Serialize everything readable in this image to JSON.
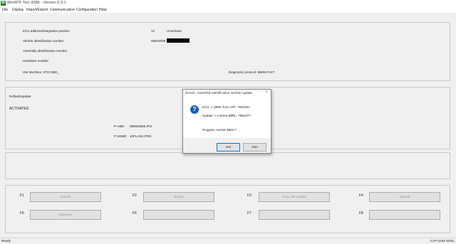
{
  "window": {
    "title": "WinKFP Tool 32Bit - Version 5.3.1"
  },
  "menu": [
    "File",
    "Display",
    "Import/Export",
    "Communication",
    "Configuration",
    "Help"
  ],
  "info": {
    "ecu_address_label": "ECU address/integration position",
    "ecu_address_value": "12",
    "ecu_address_value2": "Unverbaut",
    "vin_label": "Vehicle identification number",
    "vin_value": "WBSWD9",
    "assembly_label": "Assembly identification number",
    "hardware_label": "Hardware number",
    "hw_interface": "HW interface:  STD:OBD_",
    "diag_protocol": "Diagnostic protocol:  BMW-FAST"
  },
  "reflash": {
    "label": "Reflash/update:",
    "status": "ACTIVATED",
    "pabd_label": "P-ABD:",
    "pabd_value": "09MO3560.IPO",
    "psgbd_label": "P-SGBD:",
    "psgbd_value": "10FLASH.PRG"
  },
  "functions": [
    {
      "key": "F1",
      "label": "Zielinfo"
    },
    {
      "key": "F2",
      "label": "Expert"
    },
    {
      "key": "F3",
      "label": "Prog. ZB Update"
    },
    {
      "key": "F4",
      "label": "Spezial"
    },
    {
      "key": "F5",
      "label": "Diagnose"
    },
    {
      "key": "F6",
      "label": ""
    },
    {
      "key": "F7",
      "label": ""
    },
    {
      "key": "F8",
      "label": ""
    }
  ],
  "status": {
    "left": "Ready",
    "right": "CAP  NUM  SCRL"
  },
  "dialog": {
    "title": "Result - Assembly identification number update",
    "close": "×",
    "line1": "ECU -> ZBNr. from VrP: 7841651",
    "line2": "Update -> current ZBNr.: 7854377",
    "line3": "Program current ZBNr.?",
    "ok": "Oui",
    "cancel": "Non"
  },
  "colors": {
    "accent": "#0078d7",
    "question_icon": "#1f5fbf",
    "app_icon": "#2e7d32"
  }
}
